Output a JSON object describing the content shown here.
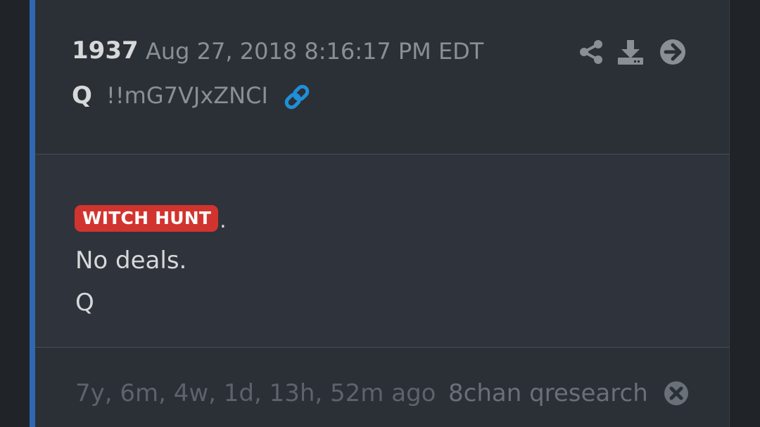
{
  "post": {
    "number": "1937",
    "date": "Aug 27, 2018 8:16:17 PM EDT",
    "author": "Q",
    "tripcode": "!!mG7VJxZNCI"
  },
  "icons": {
    "link": "link-icon",
    "share": "share-icon",
    "download": "download-icon",
    "next": "arrow-right-circle-icon",
    "close": "close-circle-icon"
  },
  "body": {
    "tag": "WITCH HUNT",
    "tag_punct": ".",
    "lines": [
      "No deals.",
      "Q"
    ]
  },
  "footer": {
    "relative_time": "7y, 6m, 4w, 1d, 13h, 52m ago",
    "source": "8chan qresearch"
  },
  "colors": {
    "accent_bar": "#2f68b0",
    "tag_bg": "#d1342f",
    "link": "#1f8fd6"
  }
}
